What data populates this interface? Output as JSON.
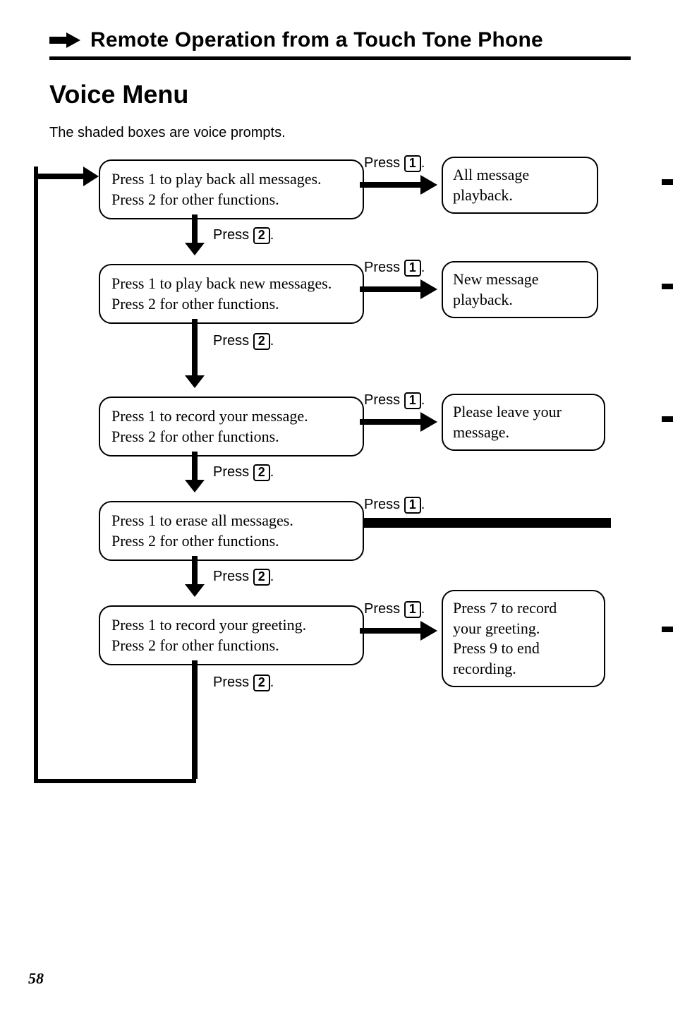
{
  "page_number": "58",
  "header": {
    "title": "Remote Operation from a Touch Tone Phone"
  },
  "section_title": "Voice Menu",
  "note": "The shaded boxes are voice prompts.",
  "key_labels": {
    "press1": "Press",
    "press2": "Press",
    "k1": "1",
    "k2": "2",
    "dot": "."
  },
  "prompts": {
    "p1l1": "Press 1 to play back all messages.",
    "p1l2": "Press 2 for other functions.",
    "p2l1": "Press 1 to play back new messages.",
    "p2l2": "Press 2 for other functions.",
    "p3l1": "Press 1 to record your message.",
    "p3l2": "Press 2 for other functions.",
    "p4l1": "Press 1 to erase all messages.",
    "p4l2": "Press 2 for other functions.",
    "p5l1": "Press 1 to record your greeting.",
    "p5l2": "Press 2 for other functions."
  },
  "results": {
    "r1l1": "All message",
    "r1l2": "playback.",
    "r2l1": "New message",
    "r2l2": "playback.",
    "r3l1": "Please leave your",
    "r3l2": "message.",
    "r5l1": "Press 7 to record",
    "r5l2": "your greeting.",
    "r5l3": "Press 9 to end",
    "r5l4": "recording."
  }
}
